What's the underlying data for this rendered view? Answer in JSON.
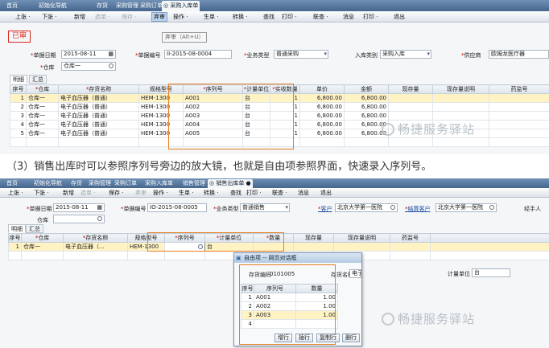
{
  "colors": {
    "highlight_box": "#e67e22",
    "stamp": "#d9281c",
    "selected_row": "#fff3c4",
    "tab_bar": "#45668e"
  },
  "screen1": {
    "tabs": [
      "首页",
      "初始化导航",
      "存货",
      "采购管理",
      "采购订单",
      "◎ 采购入库单"
    ],
    "toolbar": [
      "上张 ·",
      "下张 ·",
      "新增",
      "选单 ·",
      "保存 ·",
      "弃审",
      "操作 ·",
      "生单 ·",
      "转换 ·",
      "查找",
      "打印 ·",
      "联查 ·",
      "消息",
      "打印 ·",
      "退出"
    ],
    "stamp": "已审",
    "tooltip": "弃审（Alt+U）",
    "fields": {
      "doc_date_label": "单据日期",
      "doc_date": "2015-08-11",
      "doc_no_label": "单据编号",
      "doc_no": "II-2015-08-0004",
      "biz_type_label": "业务类型",
      "biz_type": "普通采购",
      "in_type_label": "入库类别",
      "in_type": "采购入库",
      "supplier_label": "供应商",
      "supplier": "欧姆龙医疗器",
      "warehouse_label": "仓库",
      "warehouse": "仓库一"
    },
    "subtabs": [
      "明细",
      "汇总"
    ],
    "columns": [
      "序号",
      "仓库",
      "存货名称",
      "规格型号",
      "序列号",
      "计量单位",
      "实收数量",
      "单价",
      "金额",
      "现存量",
      "现存量说明",
      "药监号"
    ],
    "rows": [
      [
        "1",
        "仓库一",
        "电子血压器（普通）",
        "HEM-1300",
        "A001",
        "台",
        "1",
        "6,800.00",
        "6,800.00"
      ],
      [
        "2",
        "仓库一",
        "电子血压器（普通）",
        "HEM-1300",
        "A002",
        "台",
        "1",
        "6,800.00",
        "6,800.00"
      ],
      [
        "3",
        "仓库一",
        "电子血压器（普通）",
        "HEM-1300",
        "A003",
        "台",
        "1",
        "6,800.00",
        "6,800.00"
      ],
      [
        "4",
        "仓库一",
        "电子血压器（普通）",
        "HEM-1300",
        "A004",
        "台",
        "1",
        "6,800.00",
        "6,800.00"
      ],
      [
        "5",
        "仓库一",
        "电子血压器（普通）",
        "HEM-1300",
        "A005",
        "台",
        "1",
        "6,800.00",
        "6,800.00"
      ]
    ]
  },
  "caption": "（3）销售出库时可以参照序列号旁边的放大镜，也就是自由项参照界面，快速录入序列号。",
  "watermark": "畅捷服务驿站",
  "screen2": {
    "tabs": [
      "首页",
      "初始化导航",
      "存货",
      "采购管理",
      "采购订单",
      "采购入库单",
      "销售管理",
      "◎ 销售出库单 ●"
    ],
    "toolbar": [
      "上张 ·",
      "下张 ·",
      "新增",
      "选单 ·",
      "保存 ·",
      "弃审",
      "操作 ·",
      "生单 ·",
      "转换 ·",
      "查找",
      "打印 ·",
      "联查 ·",
      "消息",
      "退出"
    ],
    "fields": {
      "doc_date_label": "单据日期",
      "doc_date": "2015-08-11",
      "doc_no_label": "单据编号",
      "doc_no": "IO-2015-08-0005",
      "biz_type_label": "业务类型",
      "biz_type": "普通销售",
      "customer_label": "客户",
      "customer": "北京大学第一医院",
      "settle_label": "结算客户",
      "settle_customer": "北京大学第一医院",
      "handler_label": "经手人",
      "warehouse_label": "仓库"
    },
    "subtabs": [
      "明细",
      "汇总"
    ],
    "columns": [
      "序号",
      "仓库",
      "存货名称",
      "规格型号",
      "序列号",
      "计量单位",
      "数量",
      "现存量",
      "现存量说明",
      "药监号"
    ],
    "rows": [
      [
        "1",
        "仓库一",
        "电子血压器（...",
        "HEM-1300",
        "",
        "台"
      ]
    ],
    "dialog": {
      "title": "自由项 -- 网页对话框",
      "code_label": "存货编码",
      "code": "0101005",
      "name_label": "存货名称",
      "name": "电子血压器（普通）",
      "unit_label": "计量单位",
      "unit": "台",
      "columns": [
        "序号",
        "序列号",
        "数量"
      ],
      "rows": [
        [
          "1",
          "A001",
          "1.00"
        ],
        [
          "2",
          "A002",
          "1.00"
        ],
        [
          "3",
          "A003",
          "1.00"
        ],
        [
          "4",
          "",
          ""
        ]
      ],
      "buttons": [
        "增行",
        "插行",
        "复制行",
        "删行"
      ]
    }
  }
}
